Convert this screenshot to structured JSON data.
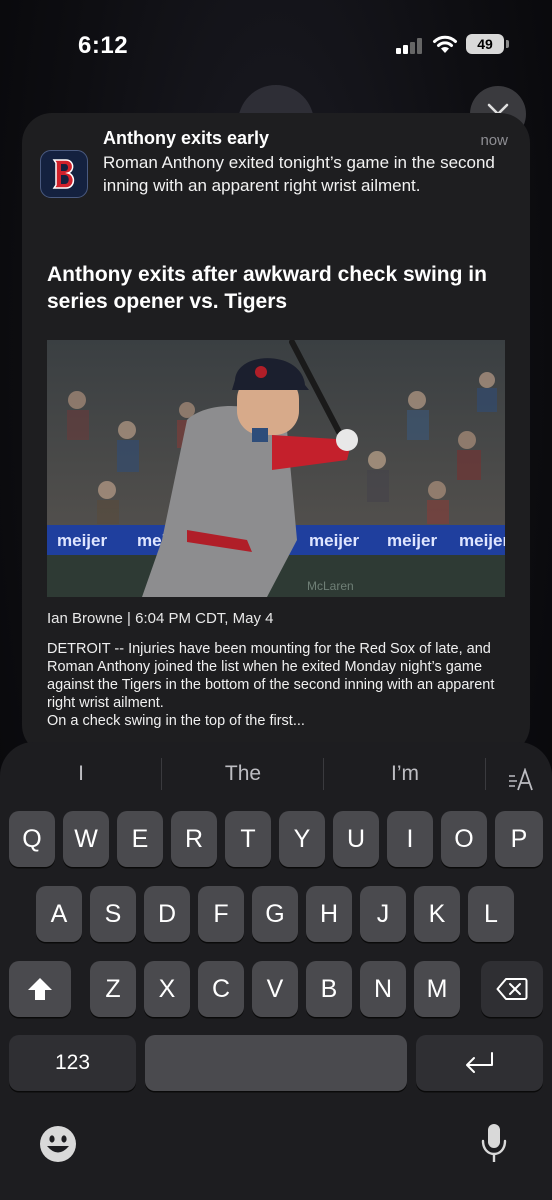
{
  "status_bar": {
    "time": "6:12",
    "battery": "49"
  },
  "notification": {
    "title": "Anthony exits early",
    "time": "now",
    "body": "Roman Anthony exited tonight’s game in the second inning with an apparent right wrist ailment.",
    "app_icon": "red-sox-b-logo"
  },
  "article": {
    "headline": "Anthony exits after awkward check swing in series opener vs. Tigers",
    "byline": "Ian Browne | 6:04 PM CDT, May 4",
    "text": "DETROIT -- Injuries have been mounting for the Red Sox of late, and Roman Anthony joined the list when he exited Monday night’s game against the Tigers in the bottom of the second inning with an apparent right wrist ailment.",
    "text2": "On a check swing in the top of the first...",
    "photo_banner": [
      "meijer",
      "meijer",
      "meijer",
      "meijer",
      "meijer",
      "meijer"
    ],
    "photo_sign": "McLaren"
  },
  "keyboard": {
    "suggestions": [
      "I",
      "The",
      "I’m"
    ],
    "row1": [
      "Q",
      "W",
      "E",
      "R",
      "T",
      "Y",
      "U",
      "I",
      "O",
      "P"
    ],
    "row2": [
      "A",
      "S",
      "D",
      "F",
      "G",
      "H",
      "J",
      "K",
      "L"
    ],
    "row3": [
      "Z",
      "X",
      "C",
      "V",
      "B",
      "N",
      "M"
    ],
    "numbers_label": "123",
    "icons": {
      "shift": "shift-icon",
      "delete": "delete-icon",
      "return": "return-icon",
      "emoji": "emoji-icon",
      "mic": "microphone-icon",
      "format": "text-format-icon"
    }
  }
}
